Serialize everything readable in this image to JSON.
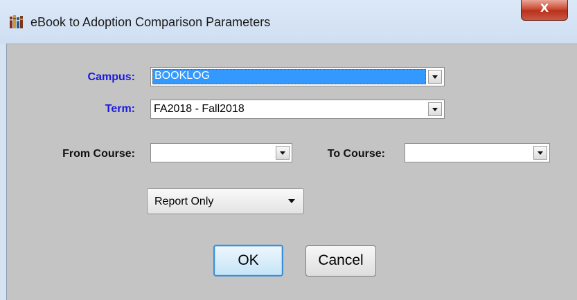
{
  "window": {
    "title": "eBook to Adoption Comparison Parameters",
    "close_label": "X"
  },
  "form": {
    "campus": {
      "label": "Campus:",
      "value": "BOOKLOG"
    },
    "term": {
      "label": "Term:",
      "value": "FA2018 - Fall2018"
    },
    "from_course": {
      "label": "From Course:",
      "value": ""
    },
    "to_course": {
      "label": "To Course:",
      "value": ""
    },
    "mode": {
      "value": "Report Only"
    }
  },
  "buttons": {
    "ok_label": "OK",
    "cancel_label": "Cancel"
  },
  "colors": {
    "label_blue": "#1a1ae0",
    "selection_blue": "#3399ff",
    "close_red": "#c8452e"
  },
  "icons": {
    "app": "books-icon",
    "close": "close-icon",
    "dropdown": "chevron-down-icon"
  }
}
